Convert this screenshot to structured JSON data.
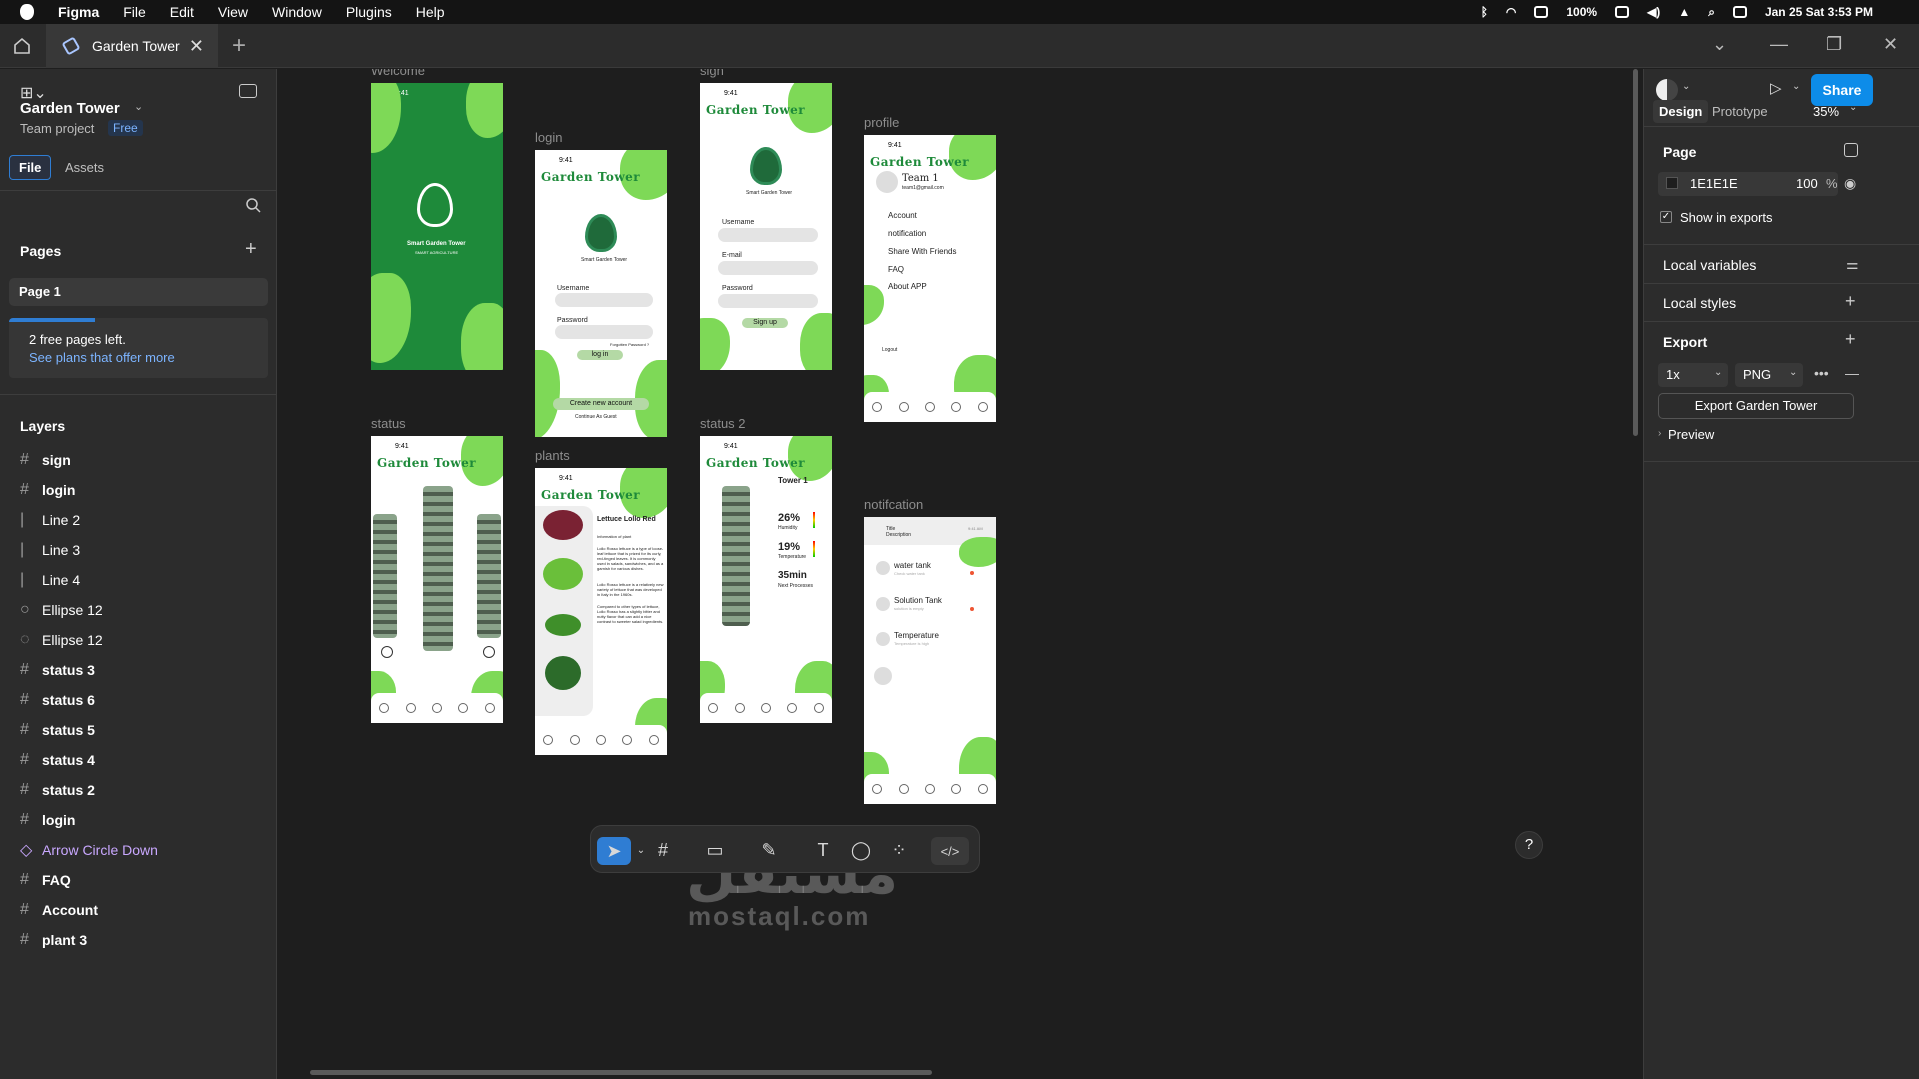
{
  "menubar": {
    "app": "Figma",
    "items": [
      "File",
      "Edit",
      "View",
      "Window",
      "Plugins",
      "Help"
    ],
    "battery": "100%",
    "datetime": "Jan 25 Sat 3:53 PM"
  },
  "tab": {
    "title": "Garden Tower"
  },
  "left": {
    "project_title": "Garden Tower",
    "team_project": "Team project",
    "plan_badge": "Free",
    "tab_file": "File",
    "tab_assets": "Assets",
    "pages_heading": "Pages",
    "page1": "Page 1",
    "free_pages": "2 free pages left.",
    "see_plans": "See plans that offer more",
    "layers_heading": "Layers",
    "layers": [
      {
        "name": "sign",
        "kind": "frame"
      },
      {
        "name": "login",
        "kind": "frame"
      },
      {
        "name": "Line 2",
        "kind": "line"
      },
      {
        "name": "Line 3",
        "kind": "line"
      },
      {
        "name": "Line 4",
        "kind": "line"
      },
      {
        "name": "Ellipse 12",
        "kind": "ellipse"
      },
      {
        "name": "Ellipse 12",
        "kind": "ellipse-arc"
      },
      {
        "name": "status 3",
        "kind": "frame"
      },
      {
        "name": "status 6",
        "kind": "frame"
      },
      {
        "name": "status 5",
        "kind": "frame"
      },
      {
        "name": "status 4",
        "kind": "frame"
      },
      {
        "name": "status 2",
        "kind": "frame"
      },
      {
        "name": "login",
        "kind": "frame"
      },
      {
        "name": "Arrow Circle Down",
        "kind": "component"
      },
      {
        "name": "FAQ",
        "kind": "frame"
      },
      {
        "name": "Account",
        "kind": "frame"
      },
      {
        "name": "plant 3",
        "kind": "frame"
      }
    ]
  },
  "right": {
    "share": "Share",
    "tab_design": "Design",
    "tab_prototype": "Prototype",
    "zoom": "35%",
    "page_heading": "Page",
    "page_color": "1E1E1E",
    "page_opacity": "100",
    "percent": "%",
    "show_in_exports": "Show in exports",
    "local_variables": "Local variables",
    "local_styles": "Local styles",
    "export_heading": "Export",
    "export_scale": "1x",
    "export_format": "PNG",
    "export_button": "Export Garden Tower",
    "preview": "Preview"
  },
  "frames": {
    "welcome": "Welcome",
    "login": "login",
    "sign": "sign",
    "profile": "profile",
    "status": "status",
    "plants": "plants",
    "status2": "status 2",
    "notification": "notifcation"
  },
  "mock": {
    "time": "9:41",
    "brand": "Garden Tower",
    "logo_name": "Smart Garden Tower",
    "logo_sub": "SMART AGRICULTURE",
    "username": "Username",
    "password": "Password",
    "email": "E-mail",
    "forgot": "Forgotten Password ?",
    "login_btn": "log in",
    "create_account": "Create new account",
    "guest": "Continue As Guest",
    "signup_btn": "Sign up",
    "team": "Team 1",
    "team_email": "team1@gmail.com",
    "menu": [
      "Account",
      "notification",
      "Share With Friends",
      "FAQ",
      "About APP"
    ],
    "logout": "Logout",
    "plant_title": "Lettuce Lollo Red",
    "plant_info": "Information of plant",
    "plant_desc1": "Lollo Rosso lettuce is a type of loose-leaf lettuce that is prized for its curly, red-tinged leaves. It is commonly used in salads, sandwiches, and as a garnish for various dishes.",
    "plant_desc2": "Lollo Rosso lettuce is a relatively new variety of lettuce that was developed in Italy in the 1960s.",
    "plant_desc3": "Compared to other types of lettuce, Lollo Rosso has a slightly bitter and nutty flavor that can add a nice contrast to sweeter salad ingredients.",
    "tower": "Tower 1",
    "humidity_val": "26%",
    "humidity": "Humidity",
    "temp_val": "19%",
    "temperature": "Temperature",
    "next_val": "35min",
    "next": "Next Processes",
    "notif_title": "Title",
    "notif_desc": "Description",
    "notif_time": "9:41 AM",
    "n1": "water tank",
    "n1s": "Check water tank",
    "n2": "Solution Tank",
    "n2s": "solution is empty",
    "n3": "Temperature",
    "n3s": "Temperature is high"
  },
  "watermark": {
    "arabic": "مستقل",
    "latin": "mostaql.com"
  },
  "help": "?"
}
